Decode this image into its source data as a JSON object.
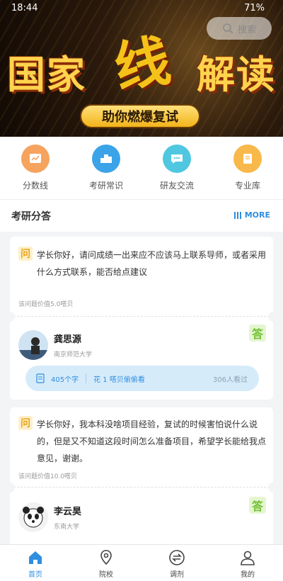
{
  "status": {
    "time": "18:44",
    "indicators": "HD ⊙ ≋ ▮",
    "battery": "71%"
  },
  "banner": {
    "search_placeholder": "搜索",
    "title_left": "国家",
    "title_mid": "线",
    "title_right": "解读",
    "subtitle": "助你燃爆复试"
  },
  "quicknav": [
    {
      "label": "分数线",
      "icon": "chart-line-icon",
      "bg": "#f6a35e"
    },
    {
      "label": "考研常识",
      "icon": "podium-icon",
      "bg": "#3ba3e8"
    },
    {
      "label": "研友交流",
      "icon": "chat-bubble-icon",
      "bg": "#4fc7e0"
    },
    {
      "label": "专业库",
      "icon": "book-icon",
      "bg": "#f8b84a"
    }
  ],
  "section": {
    "title": "考研分答",
    "more": "MORE"
  },
  "cards": [
    {
      "q_badge": "问",
      "question": "学长你好，请问成绩一出来应不应该马上联系导师，或者采用什么方式联系，能否给点建议",
      "value": "该问题价值5.0嗒贝",
      "answer_badge": "答",
      "answerer": {
        "name": "龚思源",
        "school": "南京师范大学"
      },
      "words": "405个字",
      "peek": "花 1 嗒贝偷偷看",
      "views": "306人看过"
    },
    {
      "q_badge": "问",
      "question": "学长你好，我本科没啥项目经验，复试的时候害怕说什么说的，但是又不知道这段时间怎么准备项目，希望学长能给我点意见，谢谢。",
      "value": "该问题价值10.0嗒贝",
      "answer_badge": "答",
      "answerer": {
        "name": "李云昊",
        "school": "东南大学"
      }
    }
  ],
  "tabs": [
    {
      "label": "首页",
      "icon": "home-icon",
      "active": true
    },
    {
      "label": "院校",
      "icon": "location-pin-icon",
      "active": false
    },
    {
      "label": "调剂",
      "icon": "swap-icon",
      "active": false
    },
    {
      "label": "我的",
      "icon": "user-icon",
      "active": false
    }
  ],
  "colors": {
    "accent": "#2f8ee0",
    "answer_green": "#74c134",
    "question_yellow": "#e9a620"
  }
}
